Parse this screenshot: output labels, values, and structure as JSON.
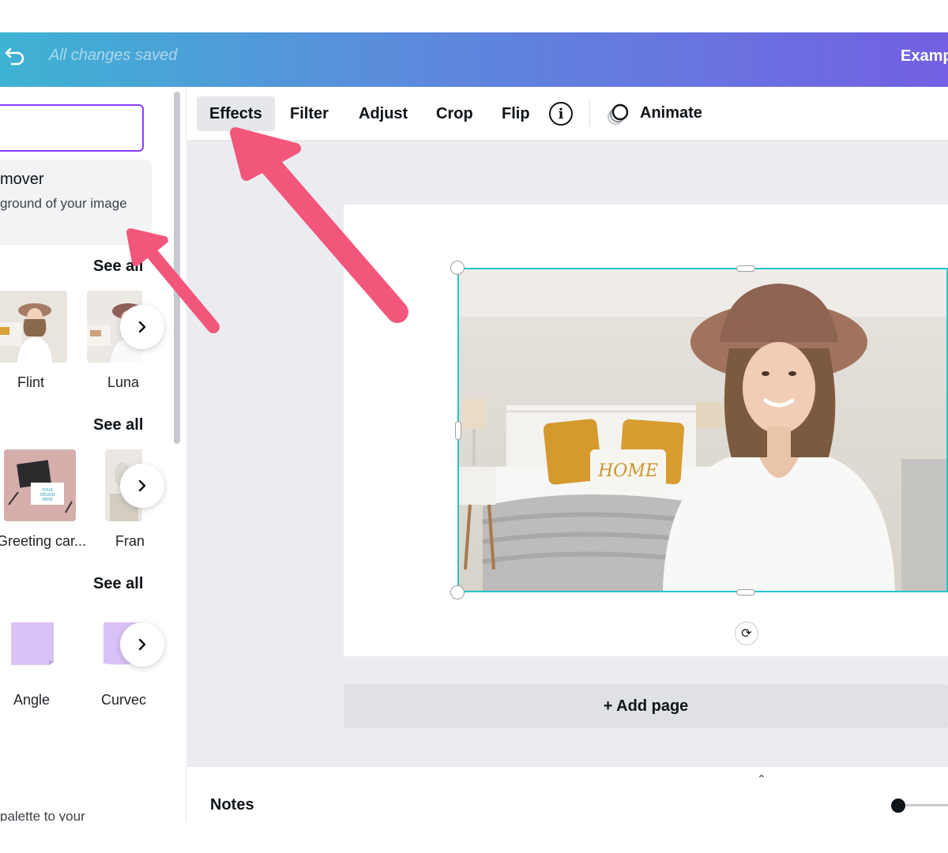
{
  "header": {
    "status": "All changes saved",
    "doc_title": "Examp",
    "gradient_start": "#3eb3d3",
    "gradient_end": "#7360e2"
  },
  "left_panel": {
    "search": {
      "value": ""
    },
    "promo": {
      "title": "mover",
      "description": "ground of your image"
    },
    "sections": [
      {
        "see_all": "See all",
        "items": [
          {
            "label": "Flint",
            "icon": "portrait-photo-thumbnail"
          },
          {
            "label": "Luna",
            "icon": "portrait-photo-thumbnail"
          }
        ]
      },
      {
        "see_all": "See all",
        "items": [
          {
            "label": "Greeting car...",
            "icon": "greeting-card-mockup-thumbnail"
          },
          {
            "label": "Fran",
            "icon": "frame-mockup-thumbnail"
          }
        ]
      },
      {
        "see_all": "See all",
        "items": [
          {
            "label": "Angle",
            "icon": "sticky-note-thumbnail"
          },
          {
            "label": "Curvec",
            "icon": "sticky-note-thumbnail"
          }
        ]
      }
    ],
    "footer_text": "palette to your"
  },
  "toolbar": {
    "effects": "Effects",
    "filter": "Filter",
    "adjust": "Adjust",
    "crop": "Crop",
    "flip": "Flip",
    "info_glyph": "i",
    "animate": "Animate"
  },
  "canvas": {
    "add_page": "+ Add page",
    "selection_color": "#25c5c9",
    "rotate_glyph": "⟳"
  },
  "notes": {
    "label": "Notes",
    "chevron": "⌃"
  },
  "annotation": {
    "arrow_color": "#f2577b"
  }
}
